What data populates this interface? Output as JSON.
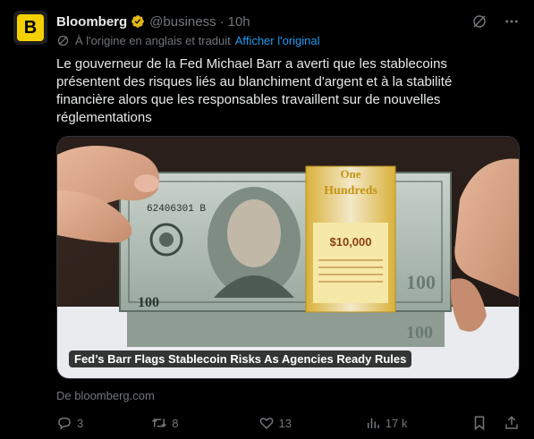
{
  "author": {
    "name": "Bloomberg",
    "handle": "@business",
    "time": "10h",
    "avatar_letter": "B",
    "verified_color": "#e2b719"
  },
  "translation": {
    "note": "À l'origine en anglais et traduit",
    "show_original": "Afficher l'original"
  },
  "tweet_text": "Le gouverneur de la Fed Michael Barr a averti que les stablecoins présentent des risques liés au blanchiment d'argent et à la stabilité financière alors que les responsables travaillent sur de nouvelles réglementations",
  "media": {
    "caption": "Fed’s Barr Flags Stablecoin Risks As Agencies Ready Rules",
    "band_text_1": "One",
    "band_text_2": "Hundreds",
    "band_amount": "$10,000",
    "bill_serial": "62406301 B",
    "bill_denomination": "100"
  },
  "source": "De bloomberg.com",
  "actions": {
    "replies": "3",
    "reposts": "8",
    "likes": "13",
    "views": "17 k"
  },
  "icons": [
    "grok-icon",
    "more-icon",
    "translate-icon",
    "reply-icon",
    "repost-icon",
    "like-icon",
    "views-icon",
    "bookmark-icon",
    "share-icon"
  ],
  "colors": {
    "link": "#1d9bf0",
    "muted": "#71767b",
    "text": "#e7e9ea",
    "brand": "#f5d000"
  }
}
